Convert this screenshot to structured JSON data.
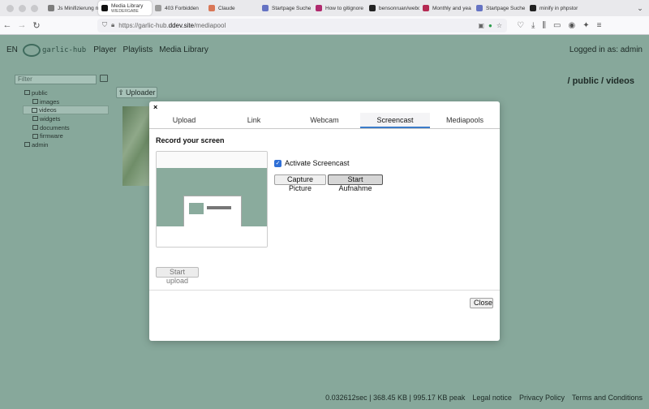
{
  "browser": {
    "tabs": [
      {
        "title": "Js Minifizierung n",
        "favicon_color": "#7c7c7c"
      },
      {
        "title": "Media Library",
        "subtitle": "WIEDERGABE",
        "favicon_color": "#111111",
        "active": true
      },
      {
        "title": "403 Forbidden",
        "favicon_color": "#9b9b9b"
      },
      {
        "title": "Claude",
        "favicon_color": "#d97757"
      },
      {
        "title": "Startpage Suche",
        "favicon_color": "#6573c3"
      },
      {
        "title": "How to gitignore",
        "favicon_color": "#b02a6e"
      },
      {
        "title": "bensonruan/webc",
        "favicon_color": "#222222"
      },
      {
        "title": "Monthly and yea",
        "favicon_color": "#b52a53"
      },
      {
        "title": "Startpage Suche",
        "favicon_color": "#6573c3"
      },
      {
        "title": "minify in phpstor",
        "favicon_color": "#222222"
      }
    ],
    "url_prefix": "https://garlic-hub.",
    "url_domain": "ddev.site",
    "url_path": "/mediapool"
  },
  "header": {
    "lang": "EN",
    "logo_text": "garlic-hub",
    "nav": [
      "Player",
      "Playlists",
      "Media Library"
    ],
    "logged_in": "Logged in as: admin"
  },
  "sidebar": {
    "filter_placeholder": "Filter",
    "tree": [
      {
        "label": "public",
        "level": 0,
        "selected": false
      },
      {
        "label": "images",
        "level": 1,
        "selected": false
      },
      {
        "label": "videos",
        "level": 1,
        "selected": true
      },
      {
        "label": "widgets",
        "level": 1,
        "selected": false
      },
      {
        "label": "documents",
        "level": 1,
        "selected": false
      },
      {
        "label": "firmware",
        "level": 1,
        "selected": false
      },
      {
        "label": "admin",
        "level": 0,
        "selected": false
      }
    ]
  },
  "main": {
    "breadcrumb": "/ public / videos",
    "uploader_label": "Uploader"
  },
  "modal": {
    "close_x": "×",
    "tabs": [
      "Upload",
      "Link",
      "Webcam",
      "Screencast",
      "Mediapools"
    ],
    "active_tab": "Screencast",
    "section_title": "Record your screen",
    "activate_label": "Activate Screencast",
    "activate_checked": true,
    "capture_label": "Capture Picture",
    "start_label": "Start Aufnahme",
    "upload_label": "Start upload",
    "close_label": "Close"
  },
  "footer": {
    "stats": "0.032612sec | 368.45 KB | 995.17 KB peak",
    "links": [
      "Legal notice",
      "Privacy Policy",
      "Terms and Conditions"
    ]
  },
  "colors": {
    "overlay_bg": "#87a89b",
    "accent": "#3b7bc9",
    "checkbox": "#2f6fd6"
  }
}
